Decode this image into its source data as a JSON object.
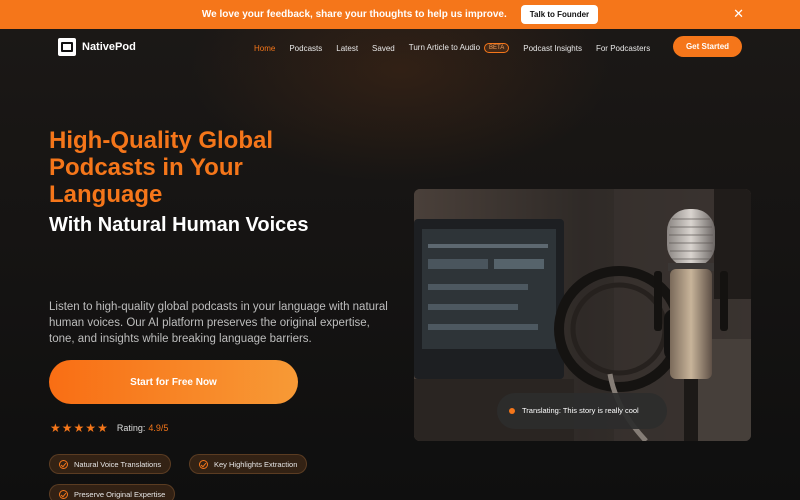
{
  "banner": {
    "message": "We love your feedback, share your thoughts to help us improve.",
    "button_label": "Talk to Founder",
    "close_icon": "close-icon"
  },
  "nav": {
    "logo_text": "NativePod",
    "links": [
      {
        "label": "Home",
        "active": true
      },
      {
        "label": "Podcasts"
      },
      {
        "label": "Latest"
      },
      {
        "label": "Saved"
      },
      {
        "label": "Turn Article to Audio",
        "badge": "BETA"
      },
      {
        "label": "Podcast Insights"
      },
      {
        "label": "For Podcasters"
      }
    ],
    "cta_label": "Get Started"
  },
  "hero": {
    "title": "High-Quality Global Podcasts in Your Language",
    "subtitle": "With Natural Human Voices",
    "description": "Listen to high-quality global podcasts in your language with natural human voices. Our AI platform preserves the original expertise, tone, and insights while breaking language barriers.",
    "cta_label": "Start for Free Now",
    "rating_label": "Rating:",
    "rating_value": "4.9/5",
    "rating_stars": 5,
    "chips": [
      "Natural Voice Translations",
      "Key Highlights Extraction",
      "Preserve Original Expertise"
    ]
  },
  "image_card": {
    "status_text": "Translating: This story is really cool"
  },
  "colors": {
    "accent": "#f5761a",
    "background": "#121212"
  }
}
